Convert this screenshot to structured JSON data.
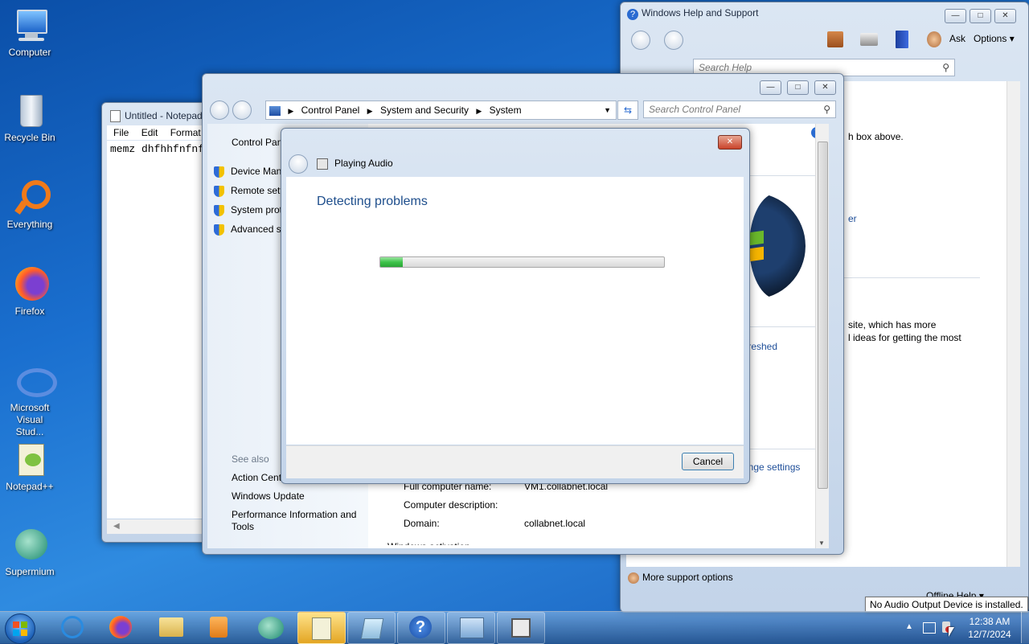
{
  "desktop": {
    "icons": [
      {
        "label": "Computer"
      },
      {
        "label": "Recycle Bin"
      },
      {
        "label": "Everything"
      },
      {
        "label": "Firefox"
      },
      {
        "label": "Microsoft Visual Stud..."
      },
      {
        "label": "Notepad++"
      },
      {
        "label": "Supermium"
      }
    ]
  },
  "help_window": {
    "title": "Windows Help and Support",
    "ask_label": "Ask",
    "options_label": "Options",
    "search_placeholder": "Search Help",
    "fragments": {
      "line1": "h box above.",
      "line2": "er",
      "line3": "site, which has more",
      "line4": "l ideas for getting the most"
    },
    "more_support": "More support options",
    "offline_help": "Offline Help"
  },
  "notepad": {
    "title": "Untitled - Notepad",
    "menu": [
      "File",
      "Edit",
      "Format"
    ],
    "content": "memz dhfhhfnfnf"
  },
  "control_panel": {
    "breadcrumb": [
      "Control Panel",
      "System and Security",
      "System"
    ],
    "search_placeholder": "Search Control Panel",
    "left_nav": {
      "home": "Control Panel Home",
      "items": [
        "Device Manager",
        "Remote settings",
        "System protection",
        "Advanced system settings"
      ],
      "see_also": "See also",
      "see_also_items": [
        "Action Center",
        "Windows Update",
        "Performance Information and Tools"
      ]
    },
    "refreshed_fragment": "freshed",
    "change_settings_fragment": "ange settings",
    "info_rows": [
      {
        "label": "Full computer name:",
        "value": "VM1.collabnet.local"
      },
      {
        "label": "Computer description:",
        "value": ""
      },
      {
        "label": "Domain:",
        "value": "collabnet.local"
      }
    ],
    "activation_fragment": "Windows activation"
  },
  "dialog": {
    "title": "Playing Audio",
    "heading": "Detecting problems",
    "progress": 0.08,
    "cancel_label": "Cancel"
  },
  "tooltip": {
    "text": "No Audio Output Device is installed."
  },
  "taskbar": {
    "time": "12:38 AM",
    "date": "12/7/2024"
  },
  "colors": {
    "link": "#1e4e99",
    "heading": "#1e4e8c",
    "progress_green": "#3ec34a"
  }
}
